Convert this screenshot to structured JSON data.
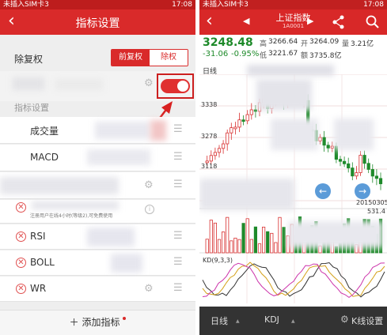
{
  "left": {
    "status": {
      "carrier": "未插入SIM卡3",
      "time": "17:08"
    },
    "header": {
      "title": "指标设置",
      "back_icon": "‹"
    },
    "rehab": {
      "label": "除复权",
      "options": [
        "前复权",
        "除权"
      ],
      "selected": "除权"
    },
    "section_title": "指标设置",
    "indicators": [
      {
        "name": "成交量"
      },
      {
        "name": "MACD"
      },
      {
        "name": ""
      },
      {
        "name": "RSI"
      },
      {
        "name": "BOLL"
      },
      {
        "name": "WR"
      }
    ],
    "notice": "注册用户在线4小时(等级2),可免费使用",
    "add_label": "添加指标",
    "accent": "#d92a2a"
  },
  "right": {
    "status": {
      "carrier": "未插入SIM卡3",
      "time": "17:08"
    },
    "header": {
      "title": "上证指数",
      "code": "1A0001"
    },
    "quote": {
      "price": "3248.48",
      "change": "-31.06",
      "change_pct": "-0.95%",
      "high_label": "高",
      "high": "3266.64",
      "open_label": "开",
      "open": "3264.09",
      "vol_label": "量",
      "vol": "3.21亿",
      "low_label": "低",
      "low": "3221.67",
      "amt_label": "额",
      "amt": "3735.8亿"
    },
    "period_label": "日线",
    "axis_labels": [
      "3338",
      "3278",
      "3118"
    ],
    "date_label": "20150305",
    "vol_axis_label": "531.4",
    "kdj_label": "KD(9,3,3)",
    "bottom_tabs": [
      "日线",
      "KDJ",
      "K线设置"
    ]
  }
}
